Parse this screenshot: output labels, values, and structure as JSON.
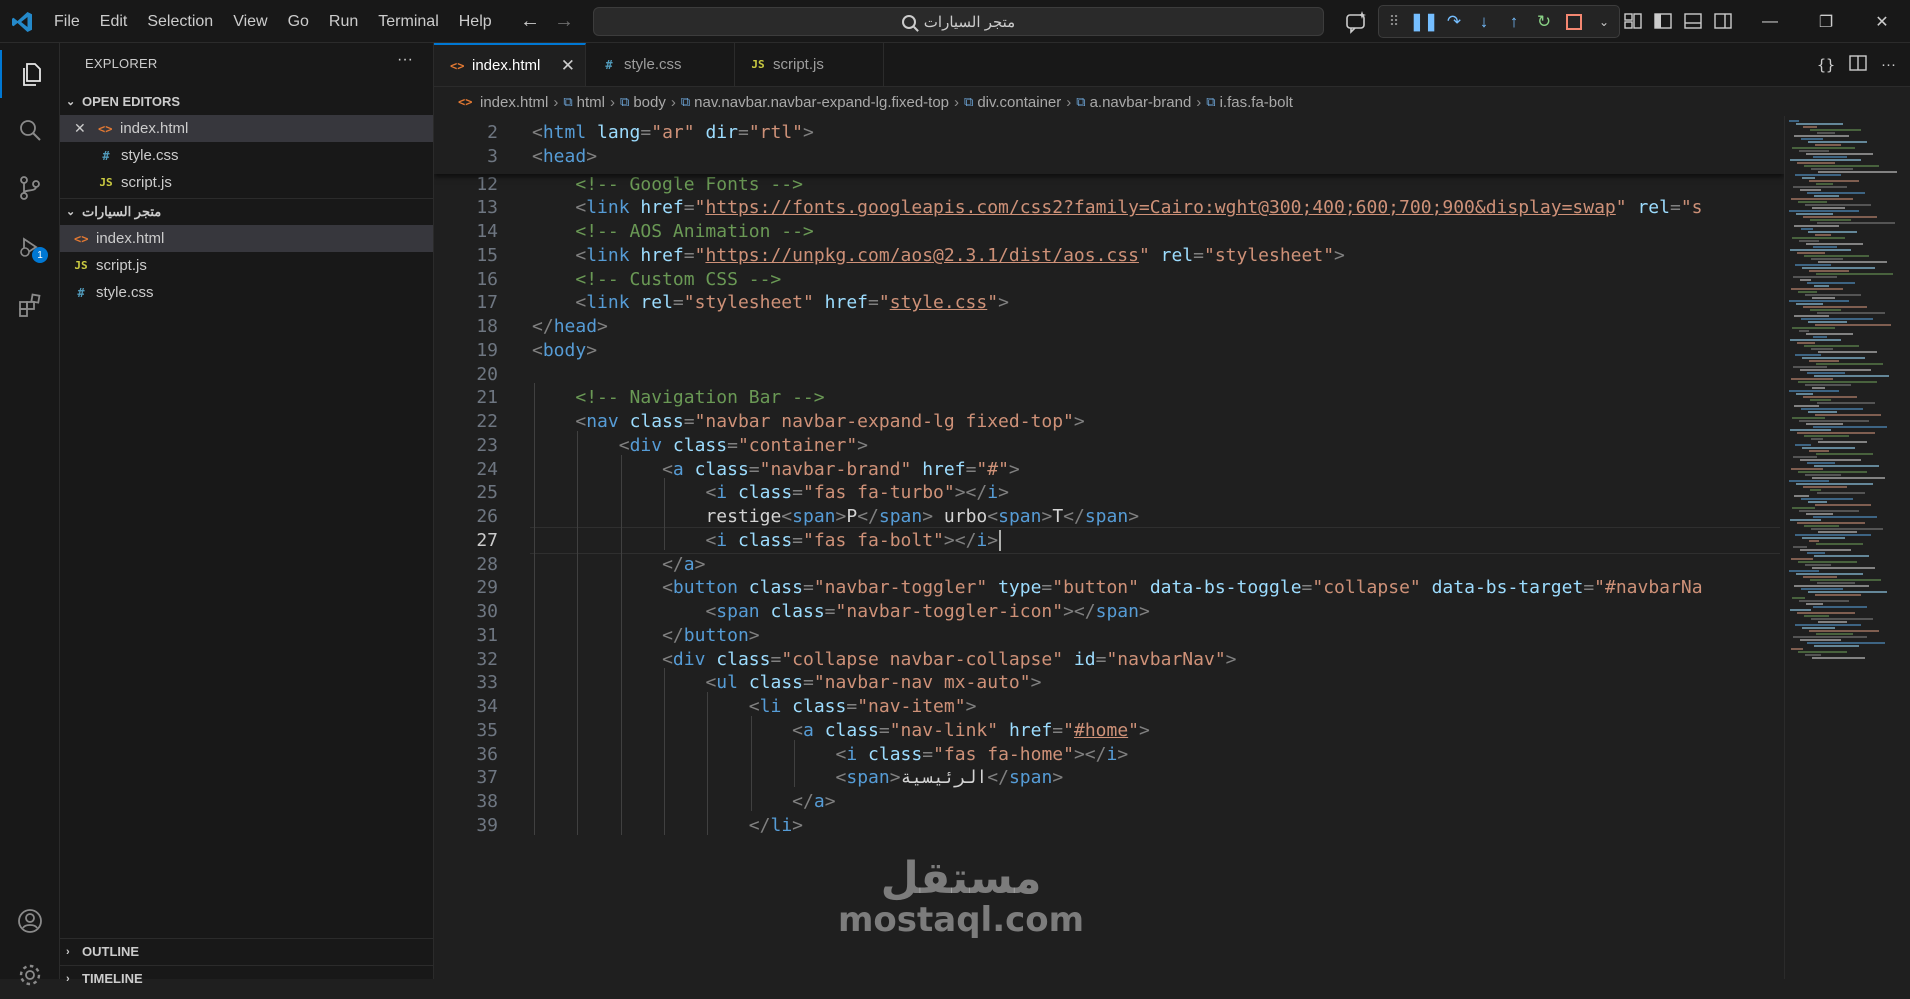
{
  "menu": [
    "File",
    "Edit",
    "Selection",
    "View",
    "Go",
    "Run",
    "Terminal",
    "Help"
  ],
  "search": {
    "text": "متجر السيارات"
  },
  "debug_badge": "1",
  "explorer": {
    "title": "EXPLORER",
    "more": "···",
    "open_editors_label": "OPEN EDITORS",
    "open_editors": [
      {
        "name": "index.html",
        "type": "html"
      },
      {
        "name": "style.css",
        "type": "css"
      },
      {
        "name": "script.js",
        "type": "js"
      }
    ],
    "folder_label": "متجر السيارات",
    "folder_files": [
      {
        "name": "index.html",
        "type": "html"
      },
      {
        "name": "script.js",
        "type": "js"
      },
      {
        "name": "style.css",
        "type": "css"
      }
    ],
    "outline_label": "OUTLINE",
    "timeline_label": "TIMELINE"
  },
  "file_icons": {
    "html": "<>",
    "css": "#",
    "js": "JS"
  },
  "tabs": [
    {
      "label": "index.html",
      "type": "html",
      "active": true
    },
    {
      "label": "style.css",
      "type": "css",
      "active": false
    },
    {
      "label": "script.js",
      "type": "js",
      "active": false
    }
  ],
  "breadcrumb": [
    "index.html",
    "html",
    "body",
    "nav.navbar.navbar-expand-lg.fixed-top",
    "div.container",
    "a.navbar-brand",
    "i.fas.fa-bolt"
  ],
  "editor": {
    "current_line": 27,
    "sticky": [
      {
        "n": 2,
        "indent": 0,
        "tokens": [
          [
            "br",
            "<"
          ],
          [
            "tag",
            "html"
          ],
          [
            "sp",
            " "
          ],
          [
            "attr",
            "lang"
          ],
          [
            "br",
            "="
          ],
          [
            "str",
            "\"ar\""
          ],
          [
            "sp",
            " "
          ],
          [
            "attr",
            "dir"
          ],
          [
            "br",
            "="
          ],
          [
            "str",
            "\"rtl\""
          ],
          [
            "br",
            ">"
          ]
        ]
      },
      {
        "n": 3,
        "indent": 0,
        "tokens": [
          [
            "br",
            "<"
          ],
          [
            "tag",
            "head"
          ],
          [
            "br",
            ">"
          ]
        ]
      }
    ],
    "lines": [
      {
        "n": 12,
        "indent": 1,
        "tokens": [
          [
            "com",
            "<!-- Google Fonts -->"
          ]
        ]
      },
      {
        "n": 13,
        "indent": 1,
        "tokens": [
          [
            "br",
            "<"
          ],
          [
            "tag",
            "link"
          ],
          [
            "sp",
            " "
          ],
          [
            "attr",
            "href"
          ],
          [
            "br",
            "="
          ],
          [
            "str",
            "\""
          ],
          [
            "stru",
            "https://fonts.googleapis.com/css2?family=Cairo:wght@300;400;600;700;900&display=swap"
          ],
          [
            "str",
            "\""
          ],
          [
            "sp",
            " "
          ],
          [
            "attr",
            "rel"
          ],
          [
            "br",
            "="
          ],
          [
            "str",
            "\"s"
          ]
        ]
      },
      {
        "n": 14,
        "indent": 1,
        "tokens": [
          [
            "com",
            "<!-- AOS Animation -->"
          ]
        ]
      },
      {
        "n": 15,
        "indent": 1,
        "tokens": [
          [
            "br",
            "<"
          ],
          [
            "tag",
            "link"
          ],
          [
            "sp",
            " "
          ],
          [
            "attr",
            "href"
          ],
          [
            "br",
            "="
          ],
          [
            "str",
            "\""
          ],
          [
            "stru",
            "https://unpkg.com/aos@2.3.1/dist/aos.css"
          ],
          [
            "str",
            "\""
          ],
          [
            "sp",
            " "
          ],
          [
            "attr",
            "rel"
          ],
          [
            "br",
            "="
          ],
          [
            "str",
            "\"stylesheet\""
          ],
          [
            "br",
            ">"
          ]
        ]
      },
      {
        "n": 16,
        "indent": 1,
        "tokens": [
          [
            "com",
            "<!-- Custom CSS -->"
          ]
        ]
      },
      {
        "n": 17,
        "indent": 1,
        "tokens": [
          [
            "br",
            "<"
          ],
          [
            "tag",
            "link"
          ],
          [
            "sp",
            " "
          ],
          [
            "attr",
            "rel"
          ],
          [
            "br",
            "="
          ],
          [
            "str",
            "\"stylesheet\""
          ],
          [
            "sp",
            " "
          ],
          [
            "attr",
            "href"
          ],
          [
            "br",
            "="
          ],
          [
            "str",
            "\""
          ],
          [
            "stru",
            "style.css"
          ],
          [
            "str",
            "\""
          ],
          [
            "br",
            ">"
          ]
        ]
      },
      {
        "n": 18,
        "indent": 0,
        "tokens": [
          [
            "br",
            "</"
          ],
          [
            "tag",
            "head"
          ],
          [
            "br",
            ">"
          ]
        ]
      },
      {
        "n": 19,
        "indent": 0,
        "tokens": [
          [
            "br",
            "<"
          ],
          [
            "tag",
            "body"
          ],
          [
            "br",
            ">"
          ]
        ]
      },
      {
        "n": 20,
        "indent": 0,
        "tokens": []
      },
      {
        "n": 21,
        "indent": 1,
        "tokens": [
          [
            "com",
            "<!-- Navigation Bar -->"
          ]
        ]
      },
      {
        "n": 22,
        "indent": 1,
        "tokens": [
          [
            "br",
            "<"
          ],
          [
            "tag",
            "nav"
          ],
          [
            "sp",
            " "
          ],
          [
            "attr",
            "class"
          ],
          [
            "br",
            "="
          ],
          [
            "str",
            "\"navbar navbar-expand-lg fixed-top\""
          ],
          [
            "br",
            ">"
          ]
        ]
      },
      {
        "n": 23,
        "indent": 2,
        "tokens": [
          [
            "br",
            "<"
          ],
          [
            "tag",
            "div"
          ],
          [
            "sp",
            " "
          ],
          [
            "attr",
            "class"
          ],
          [
            "br",
            "="
          ],
          [
            "str",
            "\"container\""
          ],
          [
            "br",
            ">"
          ]
        ]
      },
      {
        "n": 24,
        "indent": 3,
        "tokens": [
          [
            "br",
            "<"
          ],
          [
            "tag",
            "a"
          ],
          [
            "sp",
            " "
          ],
          [
            "attr",
            "class"
          ],
          [
            "br",
            "="
          ],
          [
            "str",
            "\"navbar-brand\""
          ],
          [
            "sp",
            " "
          ],
          [
            "attr",
            "href"
          ],
          [
            "br",
            "="
          ],
          [
            "str",
            "\"#\""
          ],
          [
            "br",
            ">"
          ]
        ]
      },
      {
        "n": 25,
        "indent": 4,
        "tokens": [
          [
            "br",
            "<"
          ],
          [
            "tag",
            "i"
          ],
          [
            "sp",
            " "
          ],
          [
            "attr",
            "class"
          ],
          [
            "br",
            "="
          ],
          [
            "str",
            "\"fas fa-turbo\""
          ],
          [
            "br",
            "></"
          ],
          [
            "tag",
            "i"
          ],
          [
            "br",
            ">"
          ]
        ]
      },
      {
        "n": 26,
        "indent": 4,
        "tokens": [
          [
            "txt",
            "restige"
          ],
          [
            "br",
            "<"
          ],
          [
            "tag",
            "span"
          ],
          [
            "br",
            ">"
          ],
          [
            "txt",
            "P"
          ],
          [
            "br",
            "</"
          ],
          [
            "tag",
            "span"
          ],
          [
            "br",
            ">"
          ],
          [
            "txt",
            " urbo"
          ],
          [
            "br",
            "<"
          ],
          [
            "tag",
            "span"
          ],
          [
            "br",
            ">"
          ],
          [
            "txt",
            "T"
          ],
          [
            "br",
            "</"
          ],
          [
            "tag",
            "span"
          ],
          [
            "br",
            ">"
          ]
        ]
      },
      {
        "n": 27,
        "indent": 4,
        "tokens": [
          [
            "br",
            "<"
          ],
          [
            "tag",
            "i"
          ],
          [
            "sp",
            " "
          ],
          [
            "attr",
            "class"
          ],
          [
            "br",
            "="
          ],
          [
            "str",
            "\"fas fa-bolt\""
          ],
          [
            "br",
            "></"
          ],
          [
            "tag",
            "i"
          ],
          [
            "br",
            ">"
          ]
        ]
      },
      {
        "n": 28,
        "indent": 3,
        "tokens": [
          [
            "br",
            "</"
          ],
          [
            "tag",
            "a"
          ],
          [
            "br",
            ">"
          ]
        ]
      },
      {
        "n": 29,
        "indent": 3,
        "tokens": [
          [
            "br",
            "<"
          ],
          [
            "tag",
            "button"
          ],
          [
            "sp",
            " "
          ],
          [
            "attr",
            "class"
          ],
          [
            "br",
            "="
          ],
          [
            "str",
            "\"navbar-toggler\""
          ],
          [
            "sp",
            " "
          ],
          [
            "attr",
            "type"
          ],
          [
            "br",
            "="
          ],
          [
            "str",
            "\"button\""
          ],
          [
            "sp",
            " "
          ],
          [
            "attr",
            "data-bs-toggle"
          ],
          [
            "br",
            "="
          ],
          [
            "str",
            "\"collapse\""
          ],
          [
            "sp",
            " "
          ],
          [
            "attr",
            "data-bs-target"
          ],
          [
            "br",
            "="
          ],
          [
            "str",
            "\"#navbarNa"
          ]
        ]
      },
      {
        "n": 30,
        "indent": 4,
        "tokens": [
          [
            "br",
            "<"
          ],
          [
            "tag",
            "span"
          ],
          [
            "sp",
            " "
          ],
          [
            "attr",
            "class"
          ],
          [
            "br",
            "="
          ],
          [
            "str",
            "\"navbar-toggler-icon\""
          ],
          [
            "br",
            "></"
          ],
          [
            "tag",
            "span"
          ],
          [
            "br",
            ">"
          ]
        ]
      },
      {
        "n": 31,
        "indent": 3,
        "tokens": [
          [
            "br",
            "</"
          ],
          [
            "tag",
            "button"
          ],
          [
            "br",
            ">"
          ]
        ]
      },
      {
        "n": 32,
        "indent": 3,
        "tokens": [
          [
            "br",
            "<"
          ],
          [
            "tag",
            "div"
          ],
          [
            "sp",
            " "
          ],
          [
            "attr",
            "class"
          ],
          [
            "br",
            "="
          ],
          [
            "str",
            "\"collapse navbar-collapse\""
          ],
          [
            "sp",
            " "
          ],
          [
            "attr",
            "id"
          ],
          [
            "br",
            "="
          ],
          [
            "str",
            "\"navbarNav\""
          ],
          [
            "br",
            ">"
          ]
        ]
      },
      {
        "n": 33,
        "indent": 4,
        "tokens": [
          [
            "br",
            "<"
          ],
          [
            "tag",
            "ul"
          ],
          [
            "sp",
            " "
          ],
          [
            "attr",
            "class"
          ],
          [
            "br",
            "="
          ],
          [
            "str",
            "\"navbar-nav mx-auto\""
          ],
          [
            "br",
            ">"
          ]
        ]
      },
      {
        "n": 34,
        "indent": 5,
        "tokens": [
          [
            "br",
            "<"
          ],
          [
            "tag",
            "li"
          ],
          [
            "sp",
            " "
          ],
          [
            "attr",
            "class"
          ],
          [
            "br",
            "="
          ],
          [
            "str",
            "\"nav-item\""
          ],
          [
            "br",
            ">"
          ]
        ]
      },
      {
        "n": 35,
        "indent": 6,
        "tokens": [
          [
            "br",
            "<"
          ],
          [
            "tag",
            "a"
          ],
          [
            "sp",
            " "
          ],
          [
            "attr",
            "class"
          ],
          [
            "br",
            "="
          ],
          [
            "str",
            "\"nav-link\""
          ],
          [
            "sp",
            " "
          ],
          [
            "attr",
            "href"
          ],
          [
            "br",
            "="
          ],
          [
            "str",
            "\""
          ],
          [
            "stru",
            "#home"
          ],
          [
            "str",
            "\""
          ],
          [
            "br",
            ">"
          ]
        ]
      },
      {
        "n": 36,
        "indent": 7,
        "tokens": [
          [
            "br",
            "<"
          ],
          [
            "tag",
            "i"
          ],
          [
            "sp",
            " "
          ],
          [
            "attr",
            "class"
          ],
          [
            "br",
            "="
          ],
          [
            "str",
            "\"fas fa-home\""
          ],
          [
            "br",
            "></"
          ],
          [
            "tag",
            "i"
          ],
          [
            "br",
            ">"
          ]
        ]
      },
      {
        "n": 37,
        "indent": 7,
        "tokens": [
          [
            "br",
            "<"
          ],
          [
            "tag",
            "span"
          ],
          [
            "br",
            ">"
          ],
          [
            "txt",
            "الرئيسية"
          ],
          [
            "br",
            "</"
          ],
          [
            "tag",
            "span"
          ],
          [
            "br",
            ">"
          ]
        ]
      },
      {
        "n": 38,
        "indent": 6,
        "tokens": [
          [
            "br",
            "</"
          ],
          [
            "tag",
            "a"
          ],
          [
            "br",
            ">"
          ]
        ]
      },
      {
        "n": 39,
        "indent": 5,
        "tokens": [
          [
            "br",
            "</"
          ],
          [
            "tag",
            "li"
          ],
          [
            "br",
            ">"
          ]
        ]
      }
    ]
  },
  "watermark": {
    "arabic": "مستقل",
    "latin": "mostaql.com"
  }
}
